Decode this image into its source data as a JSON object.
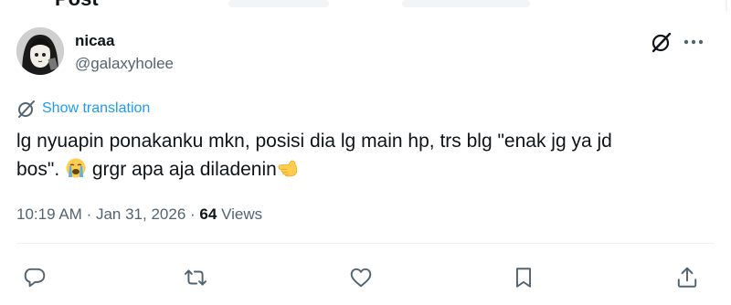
{
  "header": {
    "title": "Post"
  },
  "tweet": {
    "author_name": "nicaa",
    "author_handle": "@galaxyholee",
    "translate_label": "Show translation",
    "text_line1": "lg nyuapin ponakanku mkn, posisi dia lg main hp, trs blg \"enak jg ya jd",
    "text_line2a": "bos\".",
    "text_line2b": "grgr apa aja diladenin",
    "emoji_1": "loudly-crying-face",
    "emoji_2": "backhand-index-pointing-left",
    "time": "10:19 AM",
    "separator1": "·",
    "date": "Jan 31, 2026",
    "separator2": "·",
    "views_count": "64",
    "views_label": "Views"
  },
  "actions": [
    "reply-icon",
    "retweet-icon",
    "like-icon",
    "bookmark-icon",
    "share-icon"
  ],
  "colors": {
    "text": "#0f1419",
    "secondary": "#536471",
    "link": "#1d9bf0",
    "divider": "#eff3f4"
  }
}
